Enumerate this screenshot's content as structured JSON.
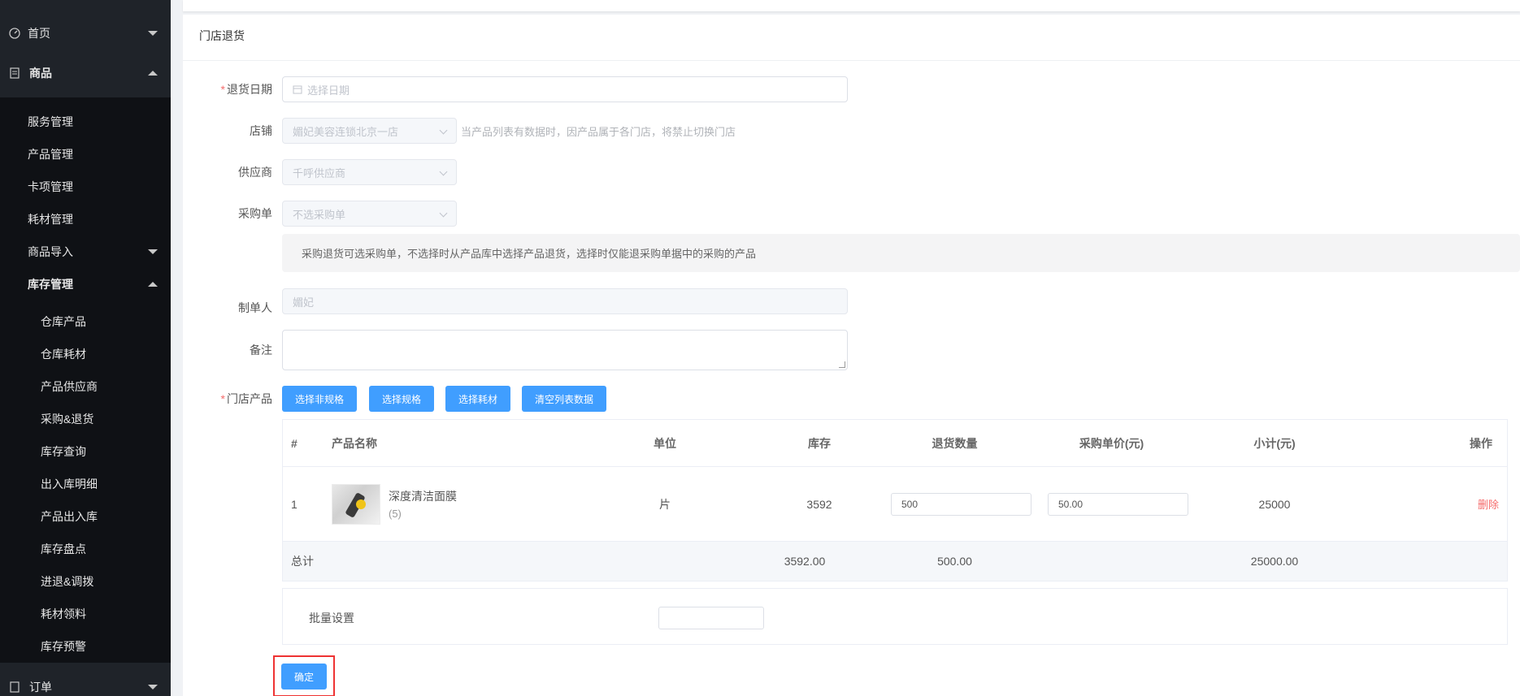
{
  "sidebar": {
    "home": "首页",
    "goods": "商品",
    "goods_sub": [
      "服务管理",
      "产品管理",
      "卡项管理",
      "耗材管理"
    ],
    "import": "商品导入",
    "stock": "库存管理",
    "stock_sub": [
      "仓库产品",
      "仓库耗材",
      "产品供应商",
      "采购&退货",
      "库存查询",
      "出入库明细",
      "产品出入库",
      "库存盘点",
      "进退&调拨",
      "耗材领料",
      "库存预警"
    ],
    "orders": "订单"
  },
  "card": {
    "title": "门店退货"
  },
  "form": {
    "date_label": "退货日期",
    "date_placeholder": "选择日期",
    "store_label": "店铺",
    "store_value": "媚妃美容连锁北京一店",
    "store_hint": "当产品列表有数据时，因产品属于各门店，将禁止切换门店",
    "supplier_label": "供应商",
    "supplier_value": "千呼供应商",
    "po_label": "采购单",
    "po_value": "不选采购单",
    "po_notice": "采购退货可选采购单，不选择时从产品库中选择产品退货，选择时仅能退采购单据中的采购的产品",
    "maker_label": "制单人",
    "maker_value": "媚妃",
    "remark_label": "备注",
    "products_label": "门店产品"
  },
  "buttons": {
    "non_spec": "选择非规格",
    "spec": "选择规格",
    "consumable": "选择耗材",
    "clear": "清空列表数据",
    "confirm": "确定"
  },
  "table": {
    "headers": {
      "index": "#",
      "name": "产品名称",
      "unit": "单位",
      "stock": "库存",
      "qty": "退货数量",
      "price": "采购单价(元)",
      "subtotal": "小计(元)",
      "ops": "操作"
    },
    "row": {
      "index": "1",
      "name": "深度清洁面膜",
      "count": "(5)",
      "unit": "片",
      "stock": "3592",
      "qty": "500",
      "price": "50.00",
      "subtotal": "25000",
      "delete": "删除"
    },
    "summary": {
      "label": "总计",
      "stock": "3592.00",
      "qty": "500.00",
      "subtotal": "25000.00"
    }
  },
  "batch": {
    "label": "批量设置"
  }
}
